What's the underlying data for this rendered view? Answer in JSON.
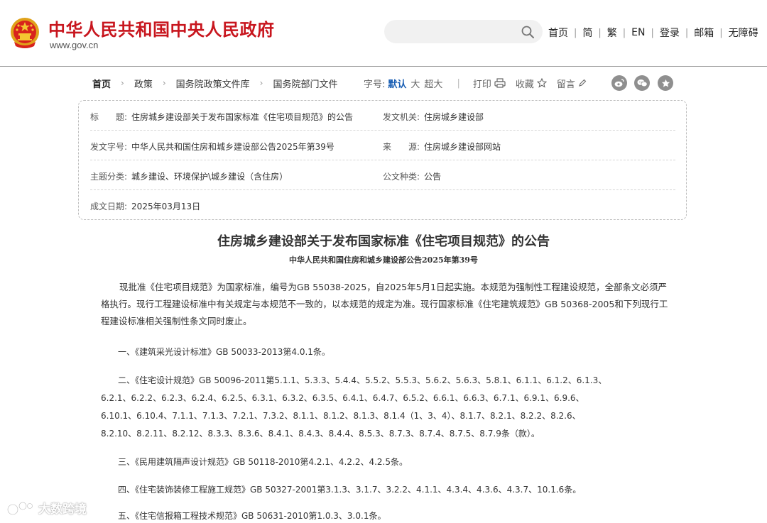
{
  "header": {
    "site_title": "中华人民共和国中央人民政府",
    "site_domain": "www.gov.cn",
    "search_placeholder": "",
    "nav": [
      "首页",
      "简",
      "繁",
      "EN",
      "登录",
      "邮箱",
      "无障碍"
    ]
  },
  "breadcrumb": {
    "items": [
      "首页",
      "政策",
      "国务院政策文件库",
      "国务院部门文件"
    ]
  },
  "tools": {
    "font_label": "字号:",
    "font_default": "默认",
    "font_large": "大",
    "font_xlarge": "超大",
    "print": "打印",
    "favorite": "收藏",
    "comment": "留言"
  },
  "share_icons": [
    "weibo-icon",
    "wechat-icon",
    "star-share-icon"
  ],
  "info": {
    "title_label": "标　　题:",
    "title_value": "住房城乡建设部关于发布国家标准《住宅项目规范》的公告",
    "issuer_label": "发文机关:",
    "issuer_value": "住房城乡建设部",
    "docno_label": "发文字号:",
    "docno_value": "中华人民共和国住房和城乡建设部公告2025年第39号",
    "source_label": "来　　源:",
    "source_value": "住房城乡建设部网站",
    "topic_label": "主题分类:",
    "topic_value": "城乡建设、环境保护\\城乡建设（含住房）",
    "type_label": "公文种类:",
    "type_value": "公告",
    "date_label": "成文日期:",
    "date_value": "2025年03月13日"
  },
  "article": {
    "title": "住房城乡建设部关于发布国家标准《住宅项目规范》的公告",
    "subtitle": "中华人民共和国住房和城乡建设部公告2025年第39号",
    "intro": "现批准《住宅项目规范》为国家标准，编号为GB 55038-2025，自2025年5月1日起实施。本规范为强制性工程建设规范，全部条文必须严格执行。现行工程建设标准中有关规定与本规范不一致的，以本规范的规定为准。现行国家标准《住宅建筑规范》GB 50368-2005和下列现行工程建设标准相关强制性条文同时废止。",
    "item1": "　　一、《建筑采光设计标准》GB 50033-2013第4.0.1条。",
    "item2_l1": "　　二、《住宅设计规范》GB 50096-2011第5.1.1、5.3.3、5.4.4、5.5.2、5.5.3、5.6.2、5.6.3、5.8.1、6.1.1、6.1.2、6.1.3、",
    "item2_l2": "6.2.1、6.2.2、6.2.3、6.2.4、6.2.5、6.3.1、6.3.2、6.3.5、6.4.1、6.4.7、6.5.2、6.6.1、6.6.3、6.7.1、6.9.1、6.9.6、",
    "item2_l3": "6.10.1、6.10.4、7.1.1、7.1.3、7.2.1、7.3.2、8.1.1、8.1.2、8.1.3、8.1.4（1、3、4）、8.1.7、8.2.1、8.2.2、8.2.6、",
    "item2_l4": "8.2.10、8.2.11、8.2.12、8.3.3、8.3.6、8.4.1、8.4.3、8.4.4、8.5.3、8.7.3、8.7.4、8.7.5、8.7.9条（款）。",
    "item3": "　　三、《民用建筑隔声设计规范》GB 50118-2010第4.2.1、4.2.2、4.2.5条。",
    "item4": "　　四、《住宅装饰装修工程施工规范》GB 50327-2001第3.1.3、3.1.7、3.2.2、4.1.1、4.3.4、4.3.6、4.3.7、10.1.6条。",
    "item5": "　　五、《住宅信报箱工程技术规范》GB 50631-2010第1.0.3、3.0.1条。"
  },
  "watermark": {
    "text": "大数跨境"
  },
  "colors": {
    "brand_red": "#c8161e",
    "link_blue": "#1a5fb4",
    "icon_gray": "#8f8f8f"
  }
}
